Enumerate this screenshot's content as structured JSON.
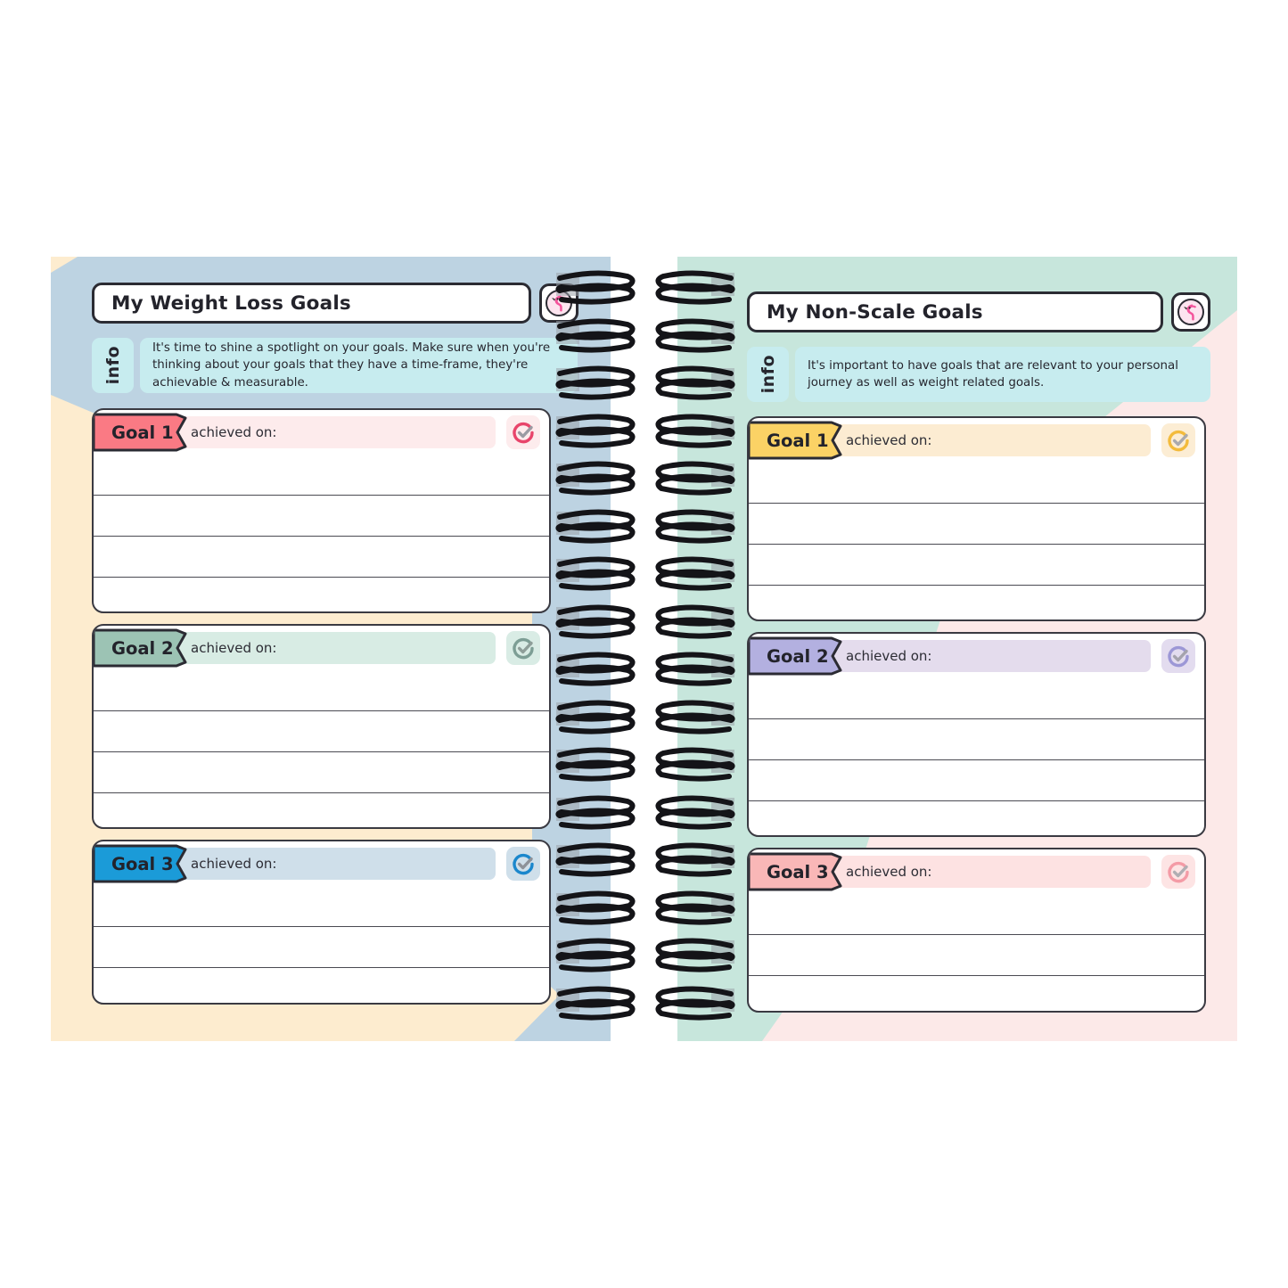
{
  "spread": {
    "coil_count": 16,
    "coil_color": "#141418"
  },
  "left_page": {
    "name": "weight-loss-goals-page",
    "bg_color": "#fdeccf",
    "accent_color": "#bdd3e2",
    "title": "My Weight Loss Goals",
    "flamingo_icon": "flamingo-icon",
    "info": {
      "tab_label": "info",
      "text": "It's time to shine a spotlight on your goals. Make sure when you're thinking about your goals that they have a time-frame, they're achievable & measurable."
    },
    "goals": [
      {
        "label": "Goal 1",
        "achieved_label": "achieved on:",
        "ribbon_color": "#fa7a84",
        "bar_color": "#fdebec",
        "check_bg": "#fdeced",
        "check_ring": "#e8456b",
        "check_mark": "#9b9ba3",
        "lines": 4
      },
      {
        "label": "Goal 2",
        "achieved_label": "achieved on:",
        "ribbon_color": "#9cc3b4",
        "bar_color": "#d8ece4",
        "check_bg": "#d9ece5",
        "check_ring": "#7d9e95",
        "check_mark": "#8e9e99",
        "lines": 4
      },
      {
        "label": "Goal 3",
        "achieved_label": "achieved on:",
        "ribbon_color": "#1b9bd8",
        "bar_color": "#cfdfea",
        "check_bg": "#cfdfea",
        "check_ring": "#1b87cc",
        "check_mark": "#8e9299",
        "lines": 3
      }
    ]
  },
  "right_page": {
    "name": "non-scale-goals-page",
    "bg_color": "#fce9e8",
    "accent_color": "#c7e6dc",
    "title": "My Non-Scale Goals",
    "flamingo_icon": "flamingo-icon",
    "info": {
      "tab_label": "info",
      "text": "It's important to have goals that are relevant to your personal journey as well as weight related goals."
    },
    "goals": [
      {
        "label": "Goal 1",
        "achieved_label": "achieved on:",
        "ribbon_color": "#fbd265",
        "bar_color": "#fcecd2",
        "check_bg": "#fcedd4",
        "check_ring": "#f3bb3c",
        "check_mark": "#a9a9ae",
        "lines": 4
      },
      {
        "label": "Goal 2",
        "achieved_label": "achieved on:",
        "ribbon_color": "#b3b0e0",
        "bar_color": "#e4dced",
        "check_bg": "#e3dcef",
        "check_ring": "#9c97d6",
        "check_mark": "#a5a3ad",
        "lines": 4
      },
      {
        "label": "Goal 3",
        "achieved_label": "achieved on:",
        "ribbon_color": "#f9b7b7",
        "bar_color": "#fde2e2",
        "check_bg": "#fde4e4",
        "check_ring": "#f49ba6",
        "check_mark": "#b0aeb3",
        "lines": 3
      }
    ]
  }
}
